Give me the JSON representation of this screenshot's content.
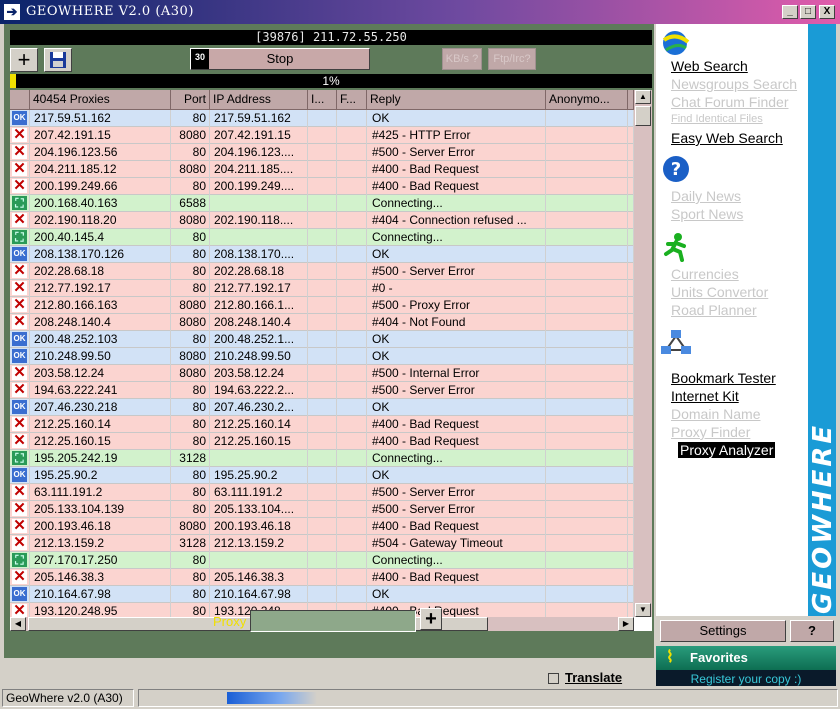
{
  "window": {
    "title": "GEOWHERE V2.0 (A30)",
    "min": "_",
    "max": "□",
    "close": "X"
  },
  "toolbar": {
    "ip_status": "[39876] 211.72.55.250",
    "add": "+",
    "timeout": "30",
    "stop_label": "Stop",
    "kbs_label": "KB/s ?",
    "ftp_label": "Ftp/Irc?",
    "progress_text": "1%",
    "progress_fraction": 0.01
  },
  "grid": {
    "columns": {
      "proxy": "40454 Proxies",
      "port": "Port",
      "ip": "IP Address",
      "i": "I...",
      "f": "F...",
      "reply": "Reply",
      "anon": "Anonymo..."
    },
    "rows": [
      {
        "status": "ok",
        "proxy": "217.59.51.162",
        "port": "80",
        "ip": "217.59.51.162",
        "reply": "OK"
      },
      {
        "status": "err",
        "proxy": "207.42.191.15",
        "port": "8080",
        "ip": "207.42.191.15",
        "reply": "#425 - HTTP Error"
      },
      {
        "status": "err",
        "proxy": "204.196.123.56",
        "port": "80",
        "ip": "204.196.123....",
        "reply": "#500 - Server Error"
      },
      {
        "status": "err",
        "proxy": "204.211.185.12",
        "port": "8080",
        "ip": "204.211.185....",
        "reply": "#400 - Bad Request"
      },
      {
        "status": "err",
        "proxy": "200.199.249.66",
        "port": "80",
        "ip": "200.199.249....",
        "reply": "#400 - Bad Request"
      },
      {
        "status": "con",
        "proxy": "200.168.40.163",
        "port": "6588",
        "ip": "",
        "reply": "Connecting..."
      },
      {
        "status": "err",
        "proxy": "202.190.118.20",
        "port": "8080",
        "ip": "202.190.118....",
        "reply": "#404 - Connection refused ..."
      },
      {
        "status": "con",
        "proxy": "200.40.145.4",
        "port": "80",
        "ip": "",
        "reply": "Connecting..."
      },
      {
        "status": "ok",
        "proxy": "208.138.170.126",
        "port": "80",
        "ip": "208.138.170....",
        "reply": "OK"
      },
      {
        "status": "err",
        "proxy": "202.28.68.18",
        "port": "80",
        "ip": "202.28.68.18",
        "reply": "#500 - Server Error"
      },
      {
        "status": "err",
        "proxy": "212.77.192.17",
        "port": "80",
        "ip": "212.77.192.17",
        "reply": "#0 -"
      },
      {
        "status": "err",
        "proxy": "212.80.166.163",
        "port": "8080",
        "ip": "212.80.166.1...",
        "reply": "#500 - Proxy Error"
      },
      {
        "status": "err",
        "proxy": "208.248.140.4",
        "port": "8080",
        "ip": "208.248.140.4",
        "reply": "#404 - Not Found"
      },
      {
        "status": "ok",
        "proxy": "200.48.252.103",
        "port": "80",
        "ip": "200.48.252.1...",
        "reply": "OK"
      },
      {
        "status": "ok",
        "proxy": "210.248.99.50",
        "port": "8080",
        "ip": "210.248.99.50",
        "reply": "OK"
      },
      {
        "status": "err",
        "proxy": "203.58.12.24",
        "port": "8080",
        "ip": "203.58.12.24",
        "reply": "#500 - Internal Error"
      },
      {
        "status": "err",
        "proxy": "194.63.222.241",
        "port": "80",
        "ip": "194.63.222.2...",
        "reply": "#500 - Server Error"
      },
      {
        "status": "ok",
        "proxy": "207.46.230.218",
        "port": "80",
        "ip": "207.46.230.2...",
        "reply": "OK"
      },
      {
        "status": "err",
        "proxy": "212.25.160.14",
        "port": "80",
        "ip": "212.25.160.14",
        "reply": "#400 - Bad Request"
      },
      {
        "status": "err",
        "proxy": "212.25.160.15",
        "port": "80",
        "ip": "212.25.160.15",
        "reply": "#400 - Bad Request"
      },
      {
        "status": "con",
        "proxy": "195.205.242.19",
        "port": "3128",
        "ip": "",
        "reply": "Connecting..."
      },
      {
        "status": "ok",
        "proxy": "195.25.90.2",
        "port": "80",
        "ip": "195.25.90.2",
        "reply": "OK"
      },
      {
        "status": "err",
        "proxy": "63.111.191.2",
        "port": "80",
        "ip": "63.111.191.2",
        "reply": "#500 - Server Error"
      },
      {
        "status": "err",
        "proxy": "205.133.104.139",
        "port": "80",
        "ip": "205.133.104....",
        "reply": "#500 - Server Error"
      },
      {
        "status": "err",
        "proxy": "200.193.46.18",
        "port": "8080",
        "ip": "200.193.46.18",
        "reply": "#400 - Bad Request"
      },
      {
        "status": "err",
        "proxy": "212.13.159.2",
        "port": "3128",
        "ip": "212.13.159.2",
        "reply": "#504 - Gateway Timeout"
      },
      {
        "status": "con",
        "proxy": "207.170.17.250",
        "port": "80",
        "ip": "",
        "reply": "Connecting..."
      },
      {
        "status": "err",
        "proxy": "205.146.38.3",
        "port": "80",
        "ip": "205.146.38.3",
        "reply": "#400 - Bad Request"
      },
      {
        "status": "ok",
        "proxy": "210.164.67.98",
        "port": "80",
        "ip": "210.164.67.98",
        "reply": "OK"
      },
      {
        "status": "err",
        "proxy": "193.120.248.95",
        "port": "80",
        "ip": "193.120.248....",
        "reply": "#400 - Bad Request"
      }
    ],
    "status_icons": {
      "ok": "OK",
      "err": "✕",
      "con": "⛶"
    }
  },
  "proxy_input": {
    "label": "Proxy",
    "value": "",
    "add": "+"
  },
  "translate": {
    "label": "Translate"
  },
  "sidebar": {
    "brand": "GEOWHERE",
    "web_search": "Web Search",
    "newsgroups_search": "Newsgroups Search",
    "chat_forum_finder": "Chat Forum Finder",
    "find_identical_files": "Find Identical Files",
    "easy_web_search": "Easy Web Search",
    "daily_news": "Daily News",
    "sport_news": "Sport News",
    "currencies": "Currencies",
    "units_convertor": "Units Convertor",
    "road_planner": "Road Planner",
    "bookmark_tester": "Bookmark Tester",
    "internet_kit": "Internet Kit",
    "domain_name": "Domain Name",
    "proxy_finder": "Proxy Finder",
    "proxy_analyzer": "Proxy Analyzer"
  },
  "bottom_right": {
    "settings": "Settings",
    "help": "?",
    "favorites": "Favorites",
    "register": "Register your copy :)"
  },
  "statusbar": {
    "text": "GeoWhere v2.0 (A30)"
  }
}
